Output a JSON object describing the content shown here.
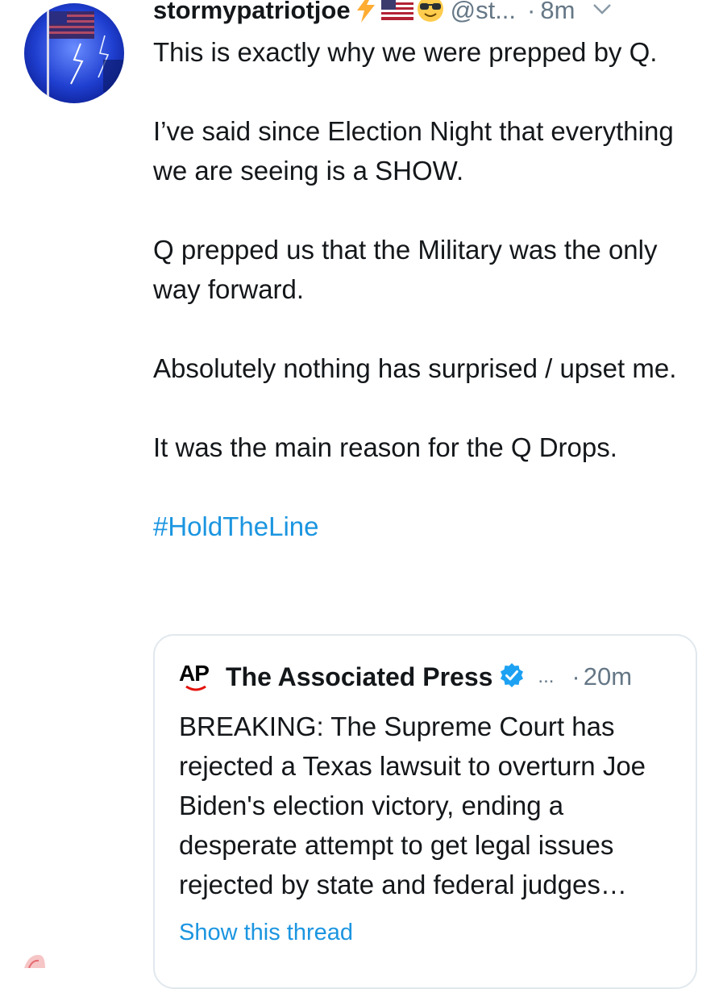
{
  "tweet": {
    "username": "stormypatriotjoe",
    "handle": "@st...",
    "dot": "·",
    "time": "8m",
    "emoji_icons": [
      "lightning-emoji",
      "us-flag-emoji",
      "sunglasses-emoji"
    ],
    "paragraphs": [
      "This is exactly why we were prepped by Q.",
      "I’ve said since Election Night that everything we are seeing is a SHOW.",
      "Q prepped us that the Military was the only way forward.",
      "Absolutely nothing has surprised / upset me.",
      "It was the main reason for the Q Drops."
    ],
    "hashtag": "#HoldTheLine"
  },
  "quoted_tweet": {
    "logo_text": "AP",
    "name": "The Associated Press",
    "handle_ellipsis": "...",
    "dot": "·",
    "time": "20m",
    "text": "BREAKING: The Supreme Court has rejected a Texas lawsuit to overturn Joe Biden's election victory, ending a desperate attempt to get legal issues rejected by state and federal judges…",
    "show_thread": "Show this thread"
  },
  "colors": {
    "text": "#14171a",
    "muted": "#657786",
    "link": "#1b95e0",
    "border": "#e1e8ed",
    "verified": "#1da1f2"
  }
}
